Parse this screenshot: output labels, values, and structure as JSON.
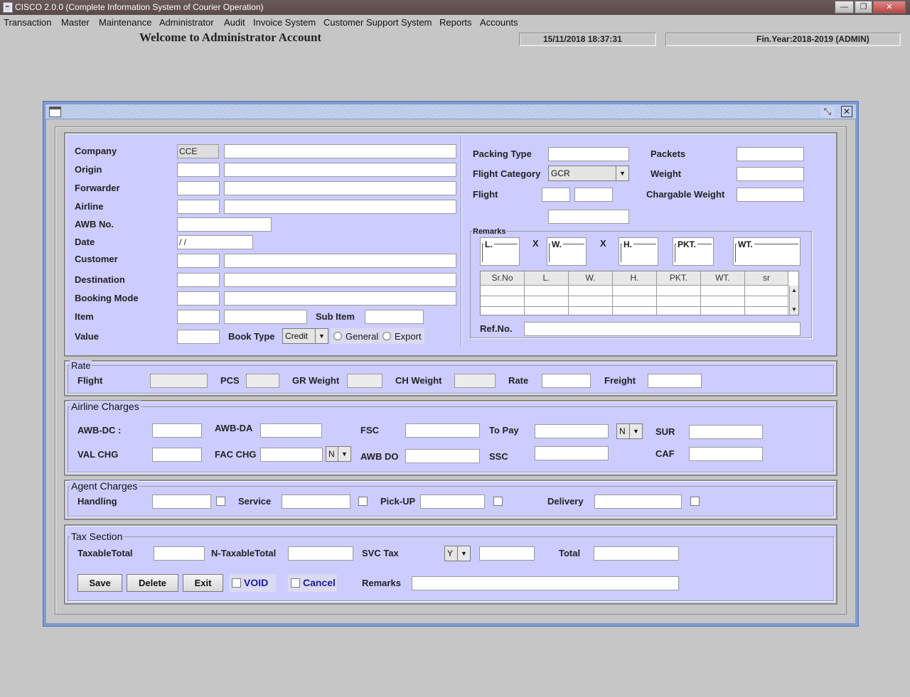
{
  "app": {
    "title": "CISCO 2.0.0 (Complete Information System of Courier Operation)",
    "icon": "java-cup-icon"
  },
  "window_buttons": {
    "minimize": "minimize-icon",
    "maximize": "maximize-icon",
    "close": "close-icon"
  },
  "menu": [
    "Transaction",
    "Master",
    "Maintenance",
    "Administrator",
    "Audit",
    "Invoice System",
    "Customer Support System",
    "Reports",
    "Accounts"
  ],
  "welcome": "Welcome to Administrator Account",
  "status": {
    "datetime": "15/11/2018    18:37:31",
    "finyear": "Fin.Year:2018-2019  (ADMIN)"
  },
  "form": {
    "left": {
      "company_label": "Company",
      "company_code": "CCE",
      "company_name": "",
      "origin_label": "Origin",
      "forwarder_label": "Forwarder",
      "airline_label": "Airline",
      "awb_label": "AWB No.",
      "date_label": "Date",
      "date_value": " / /",
      "customer_label": "Customer",
      "destination_label": "Destination",
      "booking_mode_label": "Booking Mode",
      "item_label": "Item",
      "sub_item_label": "Sub Item",
      "value_label": "Value",
      "book_type_label": "Book Type",
      "book_type_value": "Credit",
      "general_label": "General",
      "export_label": "Export"
    },
    "right": {
      "packing_type_label": "Packing Type",
      "flight_category_label": "Flight Category",
      "flight_category_value": "GCR",
      "flight_label": "Flight",
      "packets_label": "Packets",
      "weight_label": "Weight",
      "chargable_weight_label": "Chargable Weight",
      "remarks_label": "Remarks",
      "dims": {
        "l": "L.",
        "w": "W.",
        "h": "H.",
        "pkt": "PKT.",
        "wt": "WT.",
        "x": "X"
      },
      "table_headers": [
        "Sr.No",
        "L.",
        "W.",
        "H.",
        "PKT.",
        "WT.",
        "sr"
      ],
      "refno_label": "Ref.No."
    },
    "rate": {
      "title": "Rate",
      "flight_label": "Flight",
      "pcs_label": "PCS",
      "gr_weight_label": "GR Weight",
      "ch_weight_label": "CH Weight",
      "rate_label": "Rate",
      "freight_label": "Freight"
    },
    "airline_charges": {
      "title": "Airline Charges",
      "awb_dc_label": "AWB-DC :",
      "awb_da_label": "AWB-DA",
      "fsc_label": "FSC",
      "to_pay_label": "To Pay",
      "to_pay_value": "N",
      "sur_label": "SUR",
      "val_chg_label": "VAL CHG",
      "fac_chg_label": "FAC CHG",
      "fac_chg_value": "N",
      "awb_do_label": "AWB DO",
      "ssc_label": "SSC",
      "caf_label": "CAF"
    },
    "agent_charges": {
      "title": "Agent Charges",
      "handling_label": "Handling",
      "service_label": "Service",
      "pickup_label": "Pick-UP",
      "delivery_label": "Delivery"
    },
    "tax": {
      "title": "Tax Section",
      "taxable_label": "TaxableTotal",
      "ntaxable_label": "N-TaxableTotal",
      "svc_tax_label": "SVC Tax",
      "svc_tax_value": "Y",
      "total_label": "Total",
      "save": "Save",
      "delete": "Delete",
      "exit": "Exit",
      "void": "VOID",
      "cancel": "Cancel",
      "remarks_label": "Remarks"
    }
  },
  "colors": {
    "panel": "#ccccff",
    "frame": "#7e9ad0",
    "desktop": "#c6c6c6",
    "link_blue": "#1a1aa6"
  }
}
